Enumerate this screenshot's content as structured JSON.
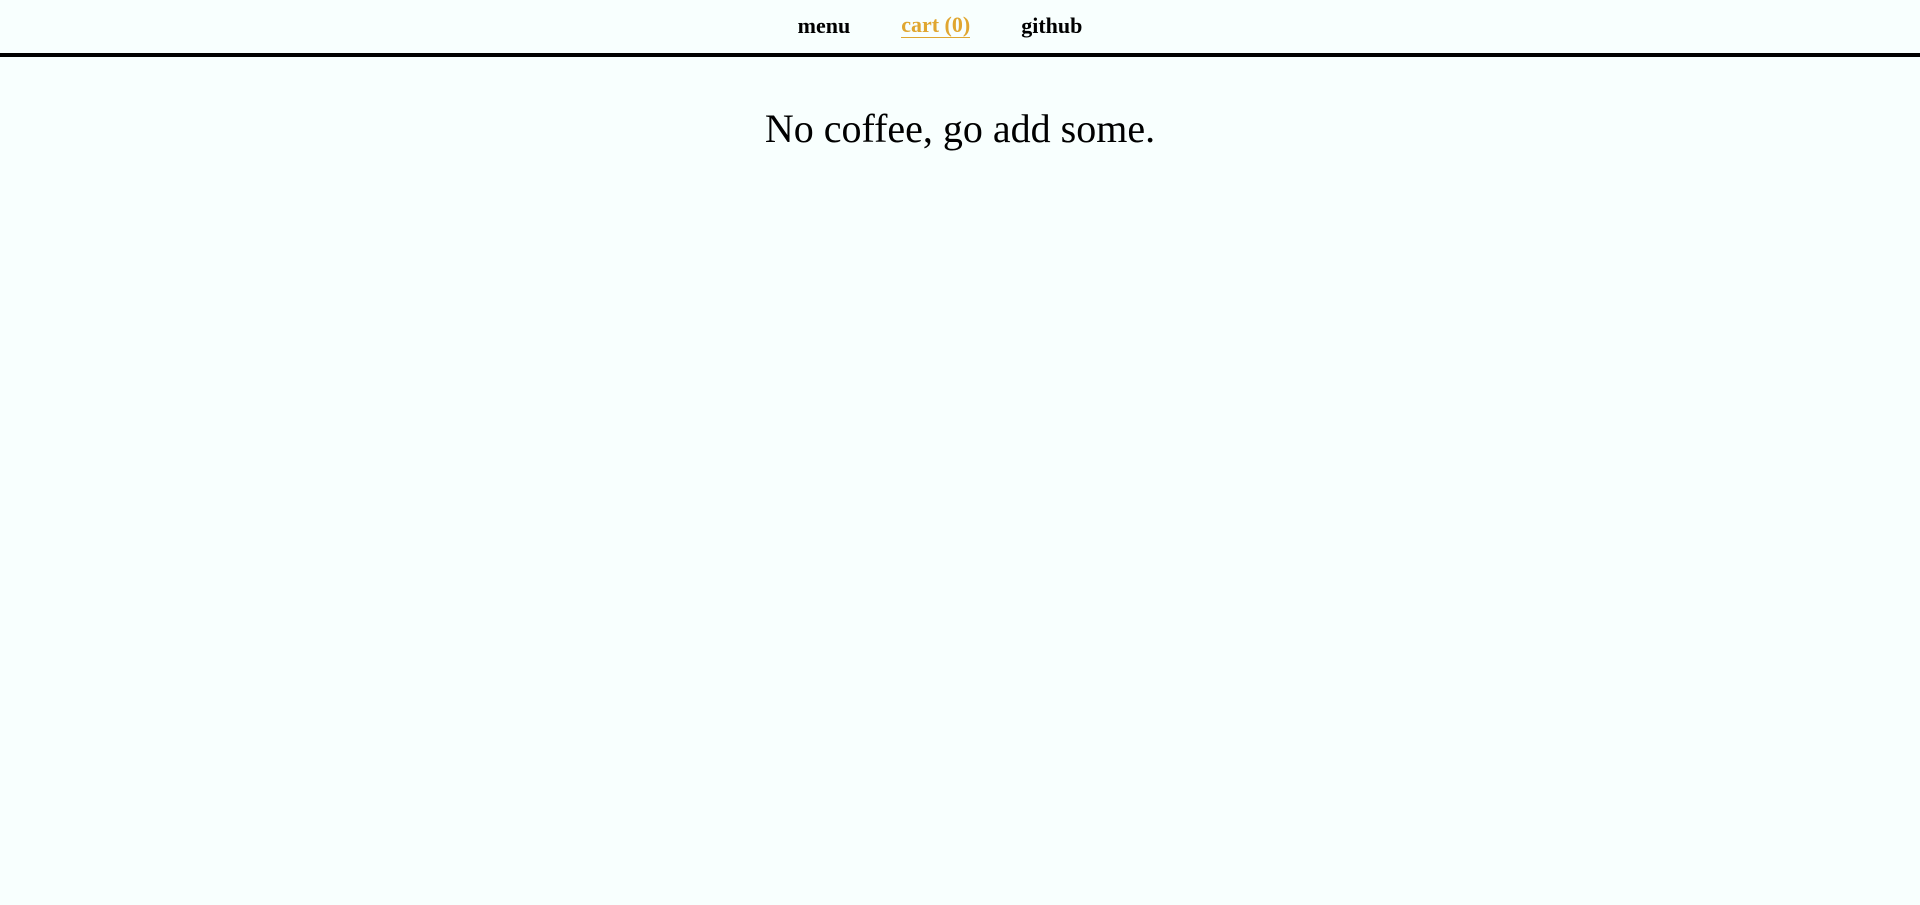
{
  "nav": {
    "items": [
      {
        "label": "menu",
        "active": false
      },
      {
        "label": "cart (0)",
        "active": true
      },
      {
        "label": "github",
        "active": false
      }
    ]
  },
  "main": {
    "empty_message": "No coffee, go add some."
  },
  "colors": {
    "background": "#f8fffe",
    "active_link": "#e0a630",
    "text": "#000000",
    "divider": "#000000"
  }
}
